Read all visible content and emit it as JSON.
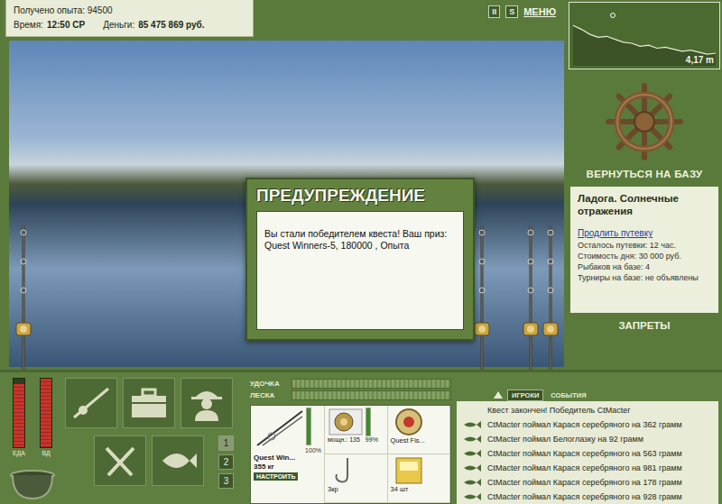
{
  "header": {
    "experience": "Получено опыта: 94500",
    "time_label": "Время:",
    "time": "12:50 СР",
    "money_label": "Деньги:",
    "money": "85 475 869 руб."
  },
  "top_controls": [
    "II",
    "S",
    "МЕНЮ"
  ],
  "depth_map": {
    "depth": "4,17 m",
    "profile": [
      1.2,
      1.6,
      2.1,
      2.4,
      2.3,
      2.6,
      2.9,
      3.0,
      3.3,
      3.2,
      3.5,
      3.4,
      3.6,
      3.8,
      3.7,
      3.9,
      4.1,
      4.0
    ]
  },
  "dialog": {
    "title": "ПРЕДУПРЕЖДЕНИЕ",
    "message": "Вы стали победителем квеста! Ваш приз: Quest Winners-5, 180000 , Опыта"
  },
  "base_panel": {
    "return_button": "ВЕРНУТЬСЯ НА БАЗУ",
    "location": "Ладога. Солнечные отражения",
    "extend_link": "Продлить путевку",
    "info": [
      "Осталось путевки: 12 час.",
      "Стоимость дня: 30 000 руб.",
      "Рыбаков на базе: 4",
      "Турниры на базе: не объявлены"
    ],
    "bans_button": "ЗАПРЕТЫ"
  },
  "gauges": [
    {
      "label": "ЕДА",
      "level": 0.92,
      "color": "#c8352b"
    },
    {
      "label": "ВД",
      "level": 1.0,
      "color": "#c8352b"
    }
  ],
  "slots": [
    {
      "label": "1",
      "selected": true
    },
    {
      "label": "2",
      "selected": false
    },
    {
      "label": "3",
      "selected": false
    }
  ],
  "equipment": {
    "rod_label": "УДОЧКА",
    "rod_level": 0.0,
    "line_label": "ЛЕСКА",
    "line_level": 0.0,
    "rod": {
      "name": "Quest Win...",
      "weight": "355 кг",
      "condition": "100%",
      "level": 1.0,
      "button": "НАСТРОИТЬ"
    },
    "reel": {
      "power": "мощн.: 135",
      "condition": "99%",
      "level": 0.99
    },
    "line": {
      "name": "Quest Fis..."
    },
    "hook": {
      "name": "3кр"
    },
    "bait": {
      "name": "34 шт"
    }
  },
  "events": {
    "tabs": [
      {
        "label": "ИГРОКИ",
        "selected": true
      },
      {
        "label": "СОБЫТИЯ",
        "selected": false
      }
    ],
    "messages": [
      {
        "text": "Квест закончен! Победитель CtMacter",
        "kind": "system"
      },
      {
        "text": "CtMacter поймал Карася серебряного на 362 грамм",
        "kind": "catch"
      },
      {
        "text": "CtMacter поймал Белоглазку на 92 грамм",
        "kind": "catch"
      },
      {
        "text": "CtMacter поймал Карася серебряного на 563 грамм",
        "kind": "catch"
      },
      {
        "text": "CtMacter поймал Карася серебряного на 981 грамм",
        "kind": "catch"
      },
      {
        "text": "CtMacter поймал Карася серебряного на 178 грамм",
        "kind": "catch"
      },
      {
        "text": "CtMacter поймал Карася серебряного на 928 грамм",
        "kind": "catch"
      }
    ]
  }
}
